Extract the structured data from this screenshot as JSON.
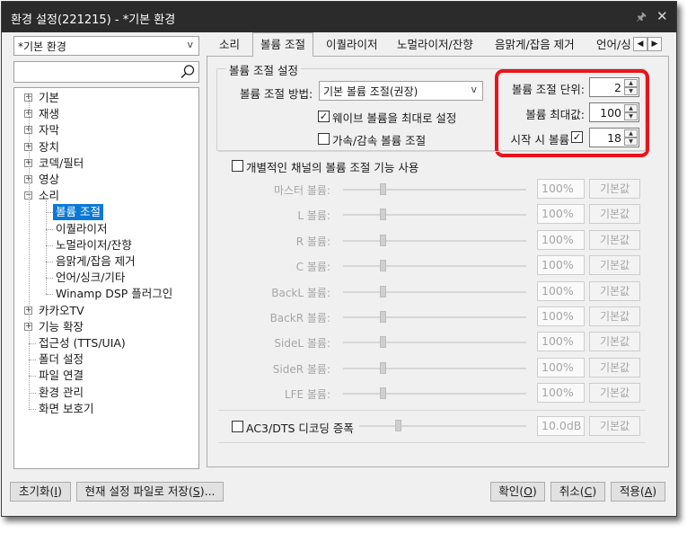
{
  "window": {
    "title": "환경 설정(221215) - *기본 환경",
    "pin_icon": "pin-icon",
    "close_icon": "close-icon"
  },
  "preset": {
    "value": "*기본 환경"
  },
  "search": {
    "placeholder": ""
  },
  "tree": {
    "items": [
      {
        "label": "기본",
        "expandable": true
      },
      {
        "label": "재생",
        "expandable": true
      },
      {
        "label": "자막",
        "expandable": true
      },
      {
        "label": "장치",
        "expandable": true
      },
      {
        "label": "코덱/필터",
        "expandable": true
      },
      {
        "label": "영상",
        "expandable": true
      },
      {
        "label": "소리",
        "expandable": true,
        "expanded": true
      },
      {
        "label": "볼륨 조절",
        "child": true,
        "selected": true
      },
      {
        "label": "이퀄라이저",
        "child": true
      },
      {
        "label": "노멀라이저/잔향",
        "child": true
      },
      {
        "label": "음맑게/잡음 제거",
        "child": true
      },
      {
        "label": "언어/싱크/기타",
        "child": true
      },
      {
        "label": "Winamp DSP 플러그인",
        "child": true
      },
      {
        "label": "카카오TV",
        "expandable": true
      },
      {
        "label": "기능 확장",
        "expandable": true
      },
      {
        "label": "접근성 (TTS/UIA)"
      },
      {
        "label": "폴더 설정"
      },
      {
        "label": "파일 연결"
      },
      {
        "label": "환경 관리"
      },
      {
        "label": "화면 보호기"
      }
    ]
  },
  "tabs": [
    {
      "label": "소리"
    },
    {
      "label": "볼륨 조절",
      "active": true
    },
    {
      "label": "이퀄라이저"
    },
    {
      "label": "노멀라이저/잔향"
    },
    {
      "label": "음맑게/잡음 제거"
    },
    {
      "label": "언어/싱"
    }
  ],
  "volume": {
    "group_title": "볼륨 조절 설정",
    "method_label": "볼륨 조절 방법:",
    "method_value": "기본 볼륨 조절(권장)",
    "wave_max_label": "웨이브 볼륨을 최대로 설정",
    "wave_max_checked": true,
    "accel_label": "가속/감속 볼륨 조절",
    "accel_checked": false,
    "step_label": "볼륨 조절 단위:",
    "step_value": "2",
    "max_label": "볼륨 최대값:",
    "max_value": "100",
    "start_label": "시작 시 볼륨",
    "start_checked": true,
    "start_value": "18"
  },
  "channels": {
    "enable_label": "개별적인 채널의 볼륨 조절 기능 사용",
    "enable_checked": false,
    "default_label": "기본값",
    "rows": [
      {
        "label": "마스터 볼륨:",
        "value": "100%",
        "level": 0.2
      },
      {
        "label": "L 볼륨:",
        "value": "100%",
        "level": 0.2
      },
      {
        "label": "R 볼륨:",
        "value": "100%",
        "level": 0.2
      },
      {
        "label": "C 볼륨:",
        "value": "100%",
        "level": 0.2
      },
      {
        "label": "BackL 볼륨:",
        "value": "100%",
        "level": 0.2
      },
      {
        "label": "BackR 볼륨:",
        "value": "100%",
        "level": 0.2
      },
      {
        "label": "SideL 볼륨:",
        "value": "100%",
        "level": 0.2
      },
      {
        "label": "SideR 볼륨:",
        "value": "100%",
        "level": 0.2
      },
      {
        "label": "LFE 볼륨:",
        "value": "100%",
        "level": 0.2
      }
    ]
  },
  "ac3": {
    "label": "AC3/DTS 디코딩 증폭",
    "checked": false,
    "value": "10.0dB",
    "default_label": "기본값",
    "level": 0.5
  },
  "buttons": {
    "reset_label": "초기화(",
    "reset_key": "I",
    "save_label": "현재 설정 파일로 저장(",
    "save_key": "S",
    "save_suffix": ")...",
    "ok_label": "확인(",
    "ok_key": "O",
    "cancel_label": "취소(",
    "cancel_key": "C",
    "apply_label": "적용(",
    "apply_key": "A",
    "close_paren": ")"
  },
  "colors": {
    "highlight_box": "#e8141c",
    "selection": "#0a78d7",
    "titlebar": "#2b2b2b"
  }
}
